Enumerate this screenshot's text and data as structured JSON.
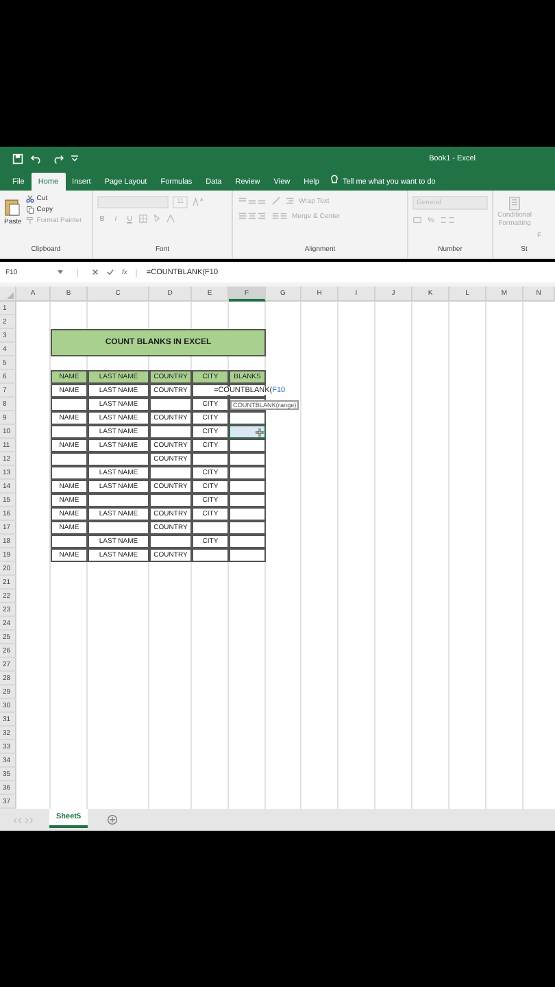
{
  "title_bar": {
    "title": "Book1  -  Excel"
  },
  "ribbon_tabs": [
    {
      "label": "File",
      "selected": false
    },
    {
      "label": "Home",
      "selected": true
    },
    {
      "label": "Insert",
      "selected": false
    },
    {
      "label": "Page Layout",
      "selected": false
    },
    {
      "label": "Formulas",
      "selected": false
    },
    {
      "label": "Data",
      "selected": false
    },
    {
      "label": "Review",
      "selected": false
    },
    {
      "label": "View",
      "selected": false
    },
    {
      "label": "Help",
      "selected": false
    }
  ],
  "tell_me": "Tell me what you want to do",
  "clipboard": {
    "paste": "Paste",
    "cut": "Cut",
    "copy": "Copy",
    "format_painter": "Format Painter",
    "label": "Clipboard"
  },
  "font": {
    "size": "11",
    "bold": "B",
    "italic": "I",
    "underline": "U",
    "label": "Font"
  },
  "alignment": {
    "wrap_text": "Wrap Text",
    "merge_center": "Merge & Center",
    "label": "Alignment"
  },
  "number": {
    "format": "General",
    "percent": "%",
    "label": "Number"
  },
  "styles": {
    "conditional": "Conditional",
    "formatting": "Formatting",
    "next_button": "F",
    "label": "St"
  },
  "formula_bar": {
    "name_box": "F10",
    "function_button": "fx",
    "formula": "=COUNTBLANK(F10"
  },
  "sheet": {
    "columns": [
      {
        "label": "A",
        "selected": false
      },
      {
        "label": "B",
        "selected": false
      },
      {
        "label": "C",
        "selected": false
      },
      {
        "label": "D",
        "selected": false
      },
      {
        "label": "E",
        "selected": false
      },
      {
        "label": "F",
        "selected": true
      },
      {
        "label": "G",
        "selected": false
      },
      {
        "label": "H",
        "selected": false
      },
      {
        "label": "I",
        "selected": false
      },
      {
        "label": "J",
        "selected": false
      },
      {
        "label": "K",
        "selected": false
      },
      {
        "label": "L",
        "selected": false
      },
      {
        "label": "M",
        "selected": false
      },
      {
        "label": "N",
        "selected": false
      }
    ],
    "row_numbers": [
      "1",
      "2",
      "3",
      "4",
      "5",
      "6",
      "7",
      "8",
      "9",
      "10",
      "11",
      "12",
      "13",
      "14",
      "15",
      "16",
      "17",
      "18",
      "19",
      "20",
      "21",
      "22",
      "23",
      "24",
      "25",
      "26",
      "27",
      "28",
      "29",
      "30",
      "31",
      "32",
      "33",
      "34",
      "35",
      "36",
      "37"
    ],
    "title": "COUNT BLANKS IN EXCEL",
    "headers": [
      "NAME",
      "LAST NAME",
      "COUNTRY",
      "CITY",
      "BLANKS"
    ],
    "records": [
      {
        "name": "NAME",
        "last_name": "LAST NAME",
        "country": "COUNTRY",
        "selected": false
      },
      {
        "last_name": "LAST NAME",
        "city": "CITY",
        "selected": false
      },
      {
        "name": "NAME",
        "last_name": "LAST NAME",
        "country": "COUNTRY",
        "city": "CITY",
        "selected": false
      },
      {
        "last_name": "LAST NAME",
        "city": "CITY",
        "selected": true
      },
      {
        "name": "NAME",
        "last_name": "LAST NAME",
        "country": "COUNTRY",
        "city": "CITY",
        "selected": false
      },
      {
        "country": "COUNTRY",
        "selected": false
      },
      {
        "last_name": "LAST NAME",
        "city": "CITY",
        "selected": false
      },
      {
        "name": "NAME",
        "last_name": "LAST NAME",
        "country": "COUNTRY",
        "city": "CITY",
        "selected": false
      },
      {
        "name": "NAME",
        "city": "CITY",
        "selected": false
      },
      {
        "name": "NAME",
        "last_name": "LAST NAME",
        "country": "COUNTRY",
        "city": "CITY",
        "selected": false
      },
      {
        "name": "NAME",
        "country": "COUNTRY",
        "selected": false
      },
      {
        "last_name": "LAST NAME",
        "city": "CITY",
        "selected": false
      },
      {
        "name": "NAME",
        "last_name": "LAST NAME",
        "country": "COUNTRY",
        "selected": false
      }
    ],
    "editing": {
      "prefix": "=COUNTBLANK(",
      "reference": "F10"
    },
    "tooltip": "COUNTBLANK(range)"
  },
  "sheet_tabs": [
    {
      "label": "Sheet5",
      "selected": true
    }
  ]
}
